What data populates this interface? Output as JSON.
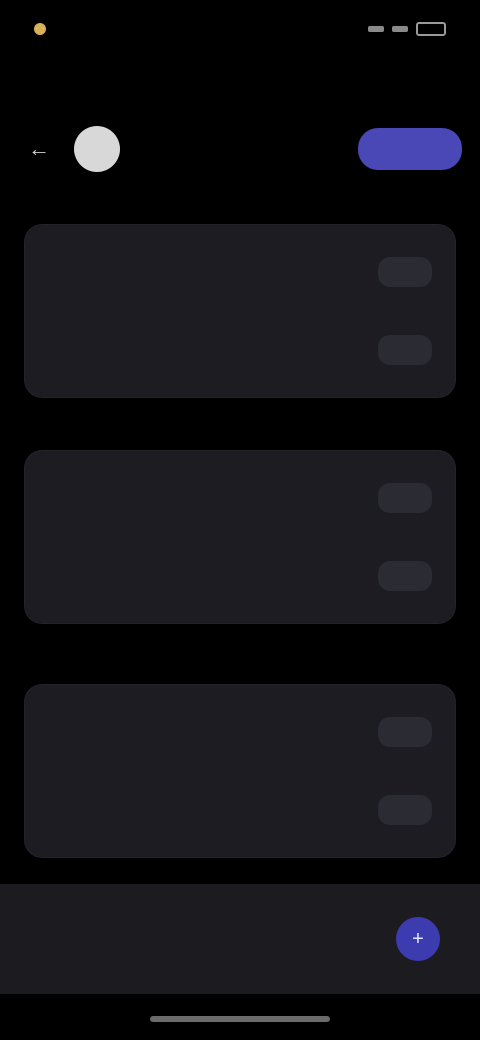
{
  "status": {
    "time": "",
    "signal": "",
    "wifi": "",
    "battery": ""
  },
  "page": {
    "title": ""
  },
  "tabs": {
    "back_icon": "arrow-left-icon",
    "center_text": "",
    "primary_label": ""
  },
  "sections": [
    {
      "title": "",
      "rows": [
        {
          "label": "",
          "action": ""
        },
        {
          "label": "",
          "action": ""
        }
      ]
    },
    {
      "title": "",
      "rows": [
        {
          "label": "",
          "action": ""
        },
        {
          "label": "",
          "action": ""
        }
      ]
    },
    {
      "title": "",
      "rows": [
        {
          "label": "",
          "action": ""
        },
        {
          "label": "",
          "action": ""
        }
      ]
    }
  ],
  "bottom": {
    "text": "",
    "fab_icon": "plus-icon"
  },
  "colors": {
    "background": "#000000",
    "card": "#1c1c22",
    "accent": "#4a47b6",
    "status_dot": "#d8b15a"
  }
}
